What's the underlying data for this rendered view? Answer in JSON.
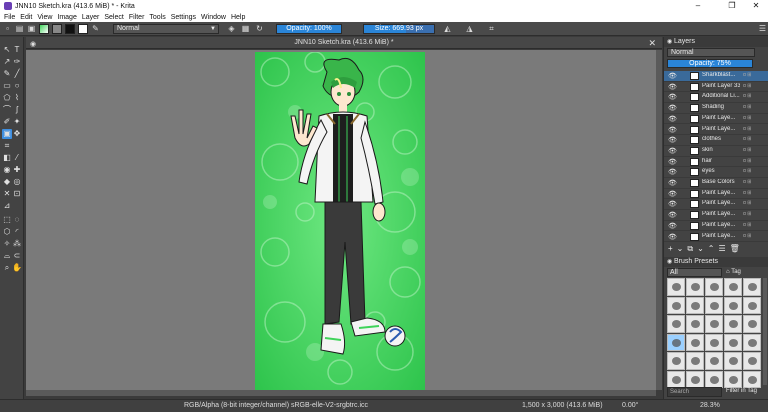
{
  "window": {
    "title": "JNN10 Sketch.kra (413.6 MiB) * - Krita",
    "controls": [
      "–",
      "❐",
      "✕"
    ]
  },
  "menu": [
    "File",
    "Edit",
    "View",
    "Image",
    "Layer",
    "Select",
    "Filter",
    "Tools",
    "Settings",
    "Window",
    "Help"
  ],
  "toolbar": {
    "blend_mode": "Normal",
    "opacity_label": "Opacity: 100%",
    "opacity_value": 1.0,
    "size_label": "Size: 669.93 px",
    "size_fraction": 0.6,
    "fg_color": "#111111",
    "bg_color": "#ffffff"
  },
  "document": {
    "tab_title": "JNN10 Sketch.kra (413.6 MiB) *"
  },
  "status": {
    "colorspace": "RGB/Alpha (8-bit integer/channel)  sRGB-elle-V2-srgbtrc.icc",
    "dimensions": "1,500 x 3,000 (413.6 MiB)",
    "rotation": "0.00°",
    "zoom": "28.3%"
  },
  "layers_panel": {
    "title": "Layers",
    "blend_mode": "Normal",
    "opacity_label": "Opacity: 75%",
    "opacity_value": 0.75,
    "layers": [
      {
        "name": "Sharkblast...",
        "selected": true
      },
      {
        "name": "Paint Layer 33",
        "selected": false
      },
      {
        "name": "Additional Li...",
        "selected": false
      },
      {
        "name": "Shading",
        "selected": false
      },
      {
        "name": "Paint Laye...",
        "selected": false
      },
      {
        "name": "Paint Laye...",
        "selected": false
      },
      {
        "name": "clothes",
        "selected": false
      },
      {
        "name": "skin",
        "selected": false
      },
      {
        "name": "hair",
        "selected": false
      },
      {
        "name": "eyes",
        "selected": false
      },
      {
        "name": "Base Colors",
        "selected": false
      },
      {
        "name": "Paint Laye...",
        "selected": false
      },
      {
        "name": "Paint Laye...",
        "selected": false
      },
      {
        "name": "Paint Laye...",
        "selected": false
      },
      {
        "name": "Paint Laye...",
        "selected": false
      },
      {
        "name": "Paint Laye...",
        "selected": false
      }
    ]
  },
  "brush_panel": {
    "title": "Brush Presets",
    "filter": "All",
    "tag_label": "Tag",
    "search_placeholder": "Search",
    "filter_in_tag": "Filter in Tag"
  },
  "colors": {
    "accent": "#2a85d8",
    "canvas_bg": "#7a7a7a",
    "art_green": "#3fd35a"
  }
}
